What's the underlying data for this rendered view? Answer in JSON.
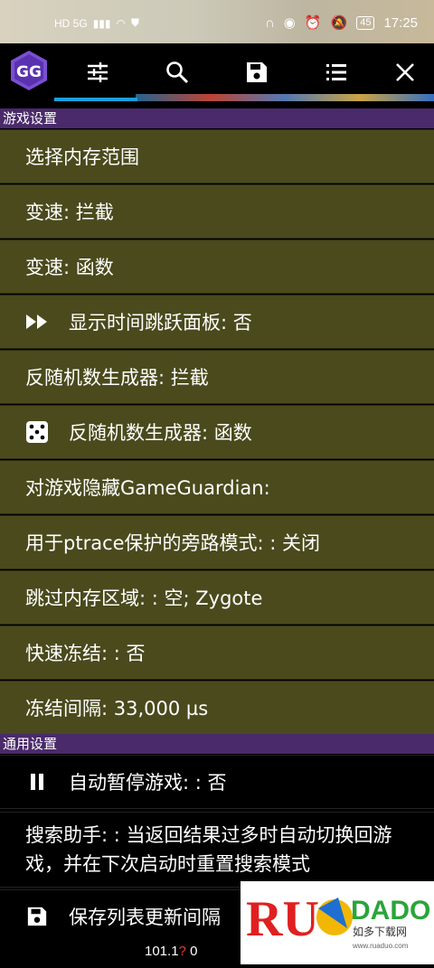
{
  "status_bar": {
    "left_indicators": "HD 5G",
    "battery": "45",
    "time": "17:25"
  },
  "toolbar": {
    "app_logo_text": "GG",
    "buttons": [
      "settings-sliders",
      "search",
      "save",
      "list",
      "close"
    ]
  },
  "sections": {
    "game_settings": "游戏设置",
    "general_settings": "通用设置"
  },
  "game_rows": [
    {
      "label": "选择内存范围"
    },
    {
      "label": "变速: 拦截"
    },
    {
      "label": "变速: 函数"
    },
    {
      "label": "显示时间跳跃面板: 否"
    },
    {
      "label": "反随机数生成器: 拦截"
    },
    {
      "label": "反随机数生成器: 函数"
    },
    {
      "label": "对游戏隐藏GameGuardian:"
    },
    {
      "label": "用于ptrace保护的旁路模式: : 关闭"
    },
    {
      "label": "跳过内存区域: : 空; Zygote"
    },
    {
      "label": "快速冻结: : 否"
    },
    {
      "label": "冻结间隔:   33,000 µs"
    }
  ],
  "general_rows": [
    {
      "label": "自动暂停游戏: : 否"
    },
    {
      "label": "搜索助手: : 当返回结果过多时自动切换回游戏，并在下次启动时重置搜索模式"
    },
    {
      "label": "保存列表更新间隔"
    }
  ],
  "bottom_status": {
    "left": "101.1",
    "mark": "?",
    "right": "0"
  },
  "watermark": {
    "logo": "RUANDADO",
    "subtitle": "如多下载网",
    "url": "www.ruaduo.com"
  },
  "colors": {
    "row_bg": "#4a4a1d",
    "section_bg": "#4a2a6a",
    "accent": "#1aa0d9"
  }
}
